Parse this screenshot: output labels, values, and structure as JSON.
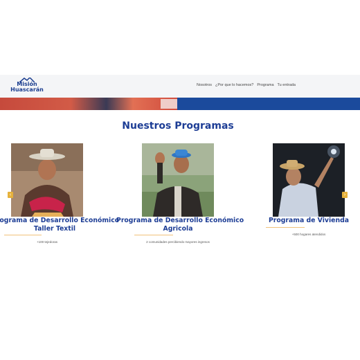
{
  "brand": {
    "line1": "Misión",
    "line2": "Huascarán"
  },
  "nav": {
    "items": [
      "Nosotros",
      "¿Por que lo hacemos?",
      "Programa",
      "Tu entrada"
    ]
  },
  "section": {
    "title": "Nuestros Programas"
  },
  "programs": [
    {
      "title_line1": "Programa de Desarrollo Económico",
      "title_line2": "Taller Textil",
      "stat": "+100 tejedoras"
    },
    {
      "title_line1": "Programa de Desarrollo Económico",
      "title_line2": "Agricola",
      "stat": "2 comunidades percibiendo mayores ingresos"
    },
    {
      "title_line1": "Programa de Vivienda",
      "title_line2": "",
      "stat": "+500 hogares atendidos"
    }
  ],
  "colors": {
    "brand_blue": "#1d3d95",
    "accent_gold": "#e6b23c",
    "underline": "#f0c17a",
    "hero_blue": "#1b4a9c"
  },
  "icons": {
    "logo": "mountain-logo-icon",
    "prev": "chevron-left-icon",
    "next": "chevron-right-icon"
  }
}
